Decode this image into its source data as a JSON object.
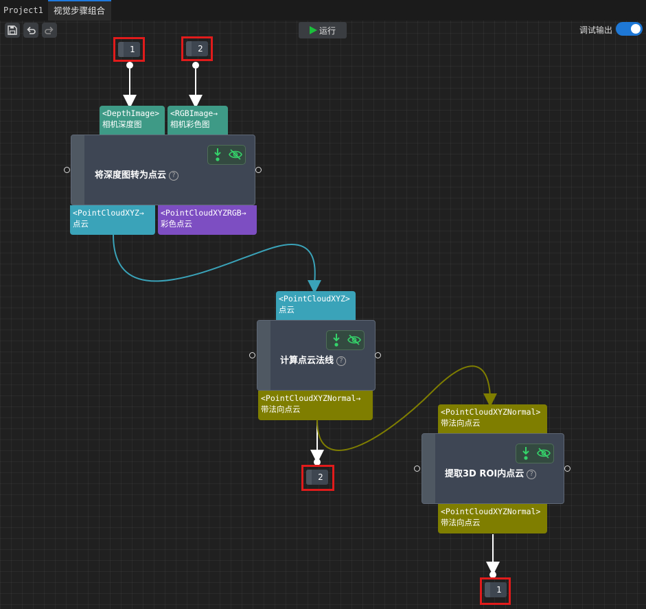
{
  "tabs": {
    "project": "Project1",
    "active": "视觉步骤组合"
  },
  "toolbar": {
    "save_icon": "save-icon",
    "undo_icon": "undo-icon",
    "redo_icon": "redo-icon",
    "run_label": "运行",
    "debug_output_label": "调试输出",
    "debug_output_enabled": true
  },
  "inputs": [
    {
      "number": "1"
    },
    {
      "number": "2"
    }
  ],
  "outputs": [
    {
      "number": "2"
    },
    {
      "number": "1"
    }
  ],
  "nodes": [
    {
      "title": "将深度图转为点云",
      "inputs": [
        {
          "type": "<DepthImage>",
          "label": "相机深度图"
        },
        {
          "type": "<RGBImage→",
          "label": "相机彩色图"
        }
      ],
      "outputs": [
        {
          "type": "<PointCloudXYZ→",
          "label": "点云"
        },
        {
          "type": "<PointCloudXYZRGB→",
          "label": "彩色点云"
        }
      ]
    },
    {
      "title": "计算点云法线",
      "inputs": [
        {
          "type": "<PointCloudXYZ>",
          "label": "点云"
        }
      ],
      "outputs": [
        {
          "type": "<PointCloudXYZNormal→",
          "label": "带法向点云"
        }
      ]
    },
    {
      "title": "提取3D ROI内点云",
      "inputs": [
        {
          "type": "<PointCloudXYZNormal>",
          "label": "带法向点云"
        }
      ],
      "outputs": [
        {
          "type": "<PointCloudXYZNormal>",
          "label": "带法向点云"
        }
      ]
    }
  ],
  "colors": {
    "depth_image": "#3e9a86",
    "point_cloud_xyz": "#3aa3b9",
    "point_cloud_xyzrgb": "#7d4ec2",
    "point_cloud_normal": "#7f7e00",
    "highlight": "#e11b1b",
    "accent": "#1e78d6"
  }
}
